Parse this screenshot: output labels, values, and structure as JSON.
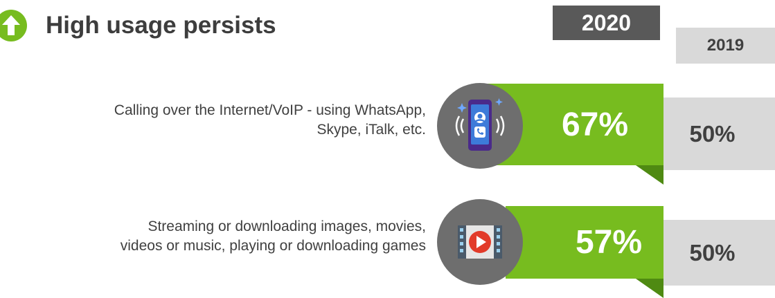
{
  "header": {
    "title": "High usage persists",
    "icon": "arrow-up-circle-icon",
    "accent_color": "#77bc1f"
  },
  "chart_data": {
    "type": "bar",
    "categories": [
      "Calling over the Internet/VoIP - using WhatsApp, Skype, iTalk, etc.",
      "Streaming or downloading images, movies, videos or music, playing or downloading games"
    ],
    "category_lines": [
      [
        "Calling over the Internet/VoIP - using WhatsApp,",
        "Skype, iTalk, etc."
      ],
      [
        "Streaming or downloading images, movies,",
        "videos or music, playing or downloading games"
      ]
    ],
    "series": [
      {
        "name": "2020",
        "values": [
          67,
          57
        ],
        "labels": [
          "67%",
          "57%"
        ],
        "color": "#77bc1f"
      },
      {
        "name": "2019",
        "values": [
          50,
          50
        ],
        "labels": [
          "50%",
          "50%"
        ],
        "color": "#d9d9d9"
      }
    ],
    "icons": [
      "smartphone-call-icon",
      "video-play-icon"
    ]
  }
}
